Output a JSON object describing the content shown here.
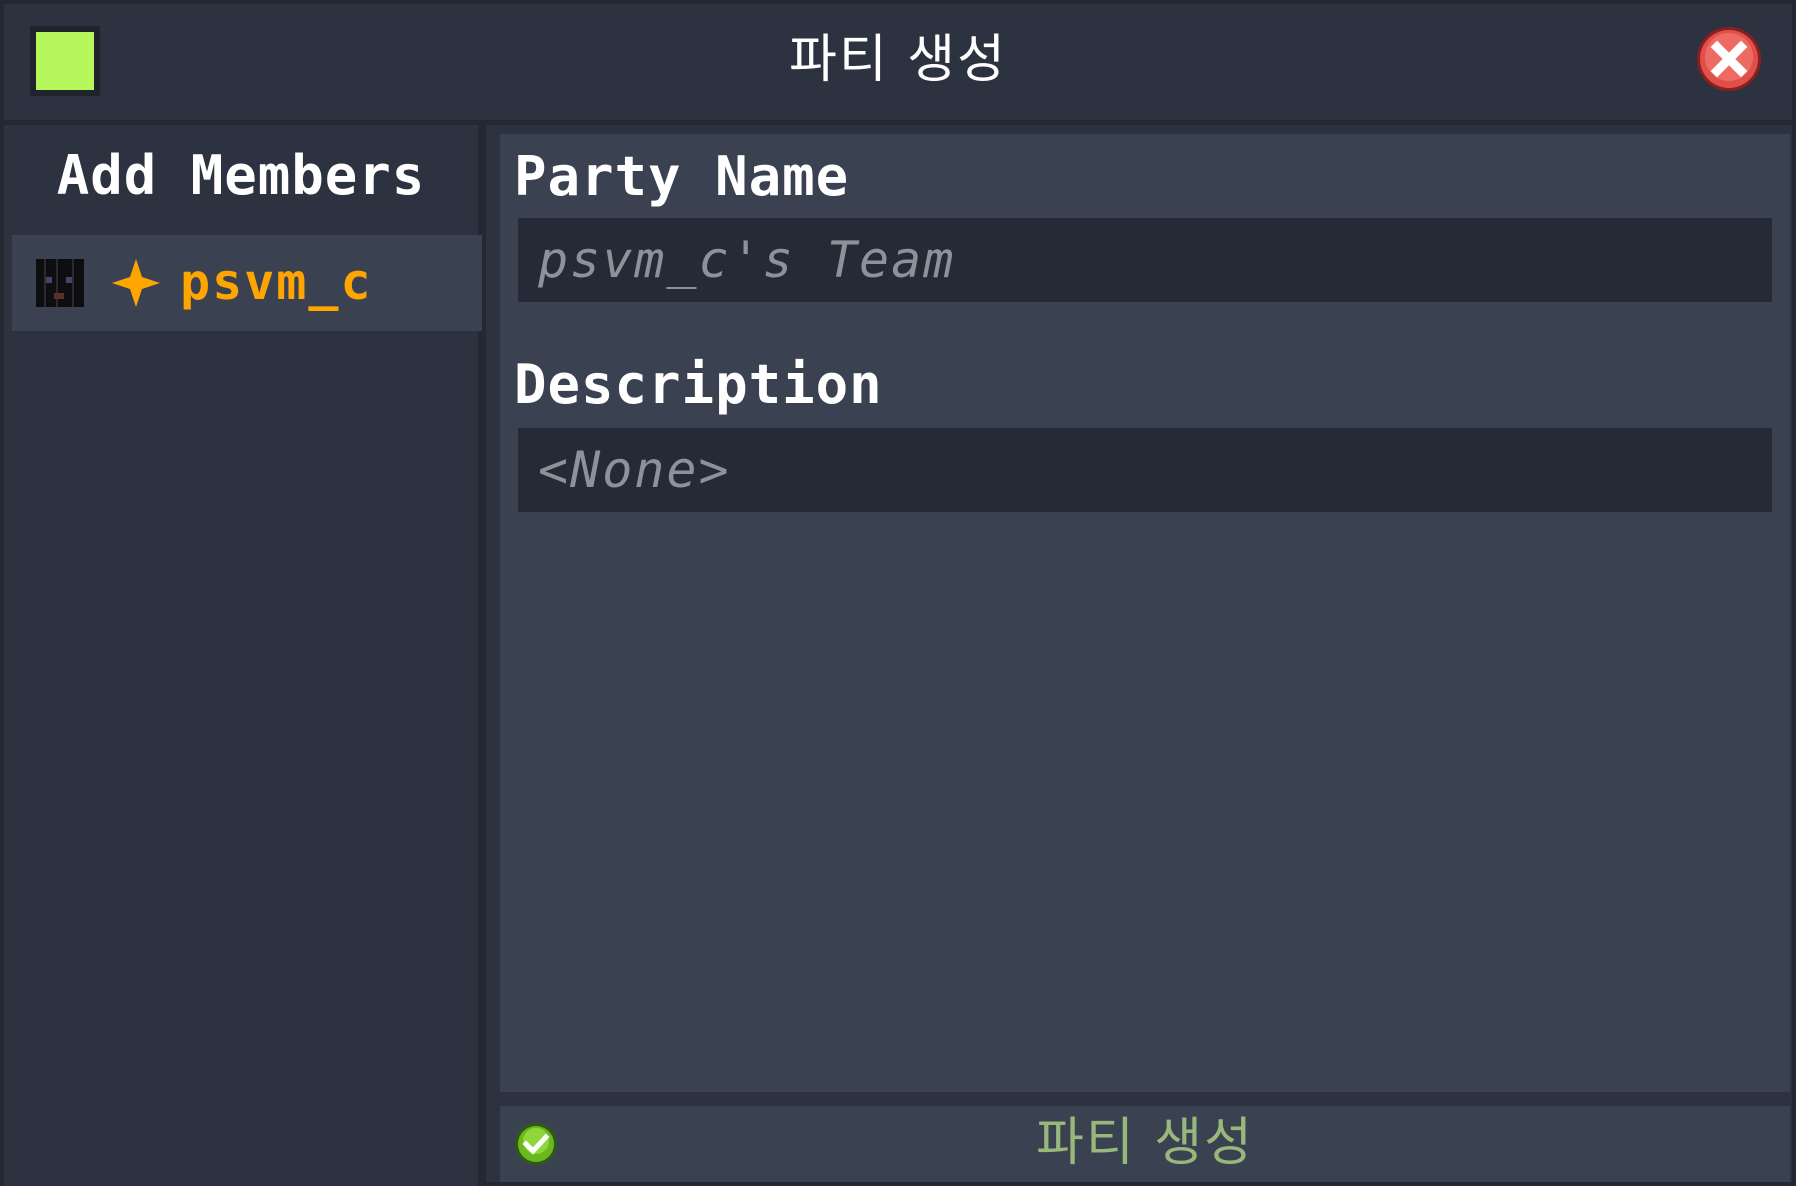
{
  "window": {
    "title": "파티 생성",
    "party_color": "#b6f75c"
  },
  "sidebar": {
    "heading": "Add Members",
    "members": [
      {
        "name": "psvm_c",
        "role_icon": "leader-star-icon",
        "name_color": "#ffa500"
      }
    ]
  },
  "form": {
    "party_name_label": "Party Name",
    "party_name_placeholder": "psvm_c's Team",
    "description_label": "Description",
    "description_placeholder": "<None>"
  },
  "footer": {
    "create_label": "파티 생성",
    "create_icon": "checkmark-icon"
  },
  "icons": {
    "close": "close-icon"
  }
}
